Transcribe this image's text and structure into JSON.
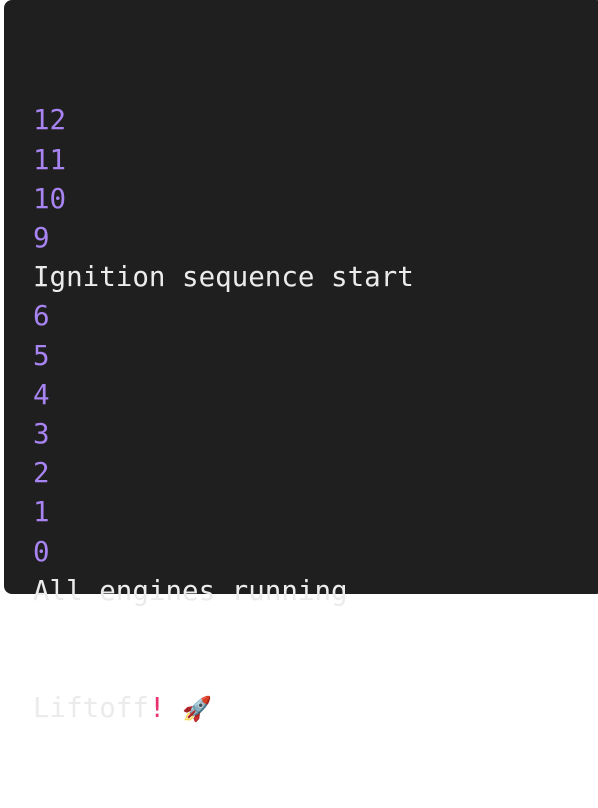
{
  "console": {
    "lines": [
      {
        "type": "number",
        "text": "12"
      },
      {
        "type": "number",
        "text": "11"
      },
      {
        "type": "number",
        "text": "10"
      },
      {
        "type": "number",
        "text": "9"
      },
      {
        "type": "text",
        "text": "Ignition sequence start"
      },
      {
        "type": "number",
        "text": "6"
      },
      {
        "type": "number",
        "text": "5"
      },
      {
        "type": "number",
        "text": "4"
      },
      {
        "type": "number",
        "text": "3"
      },
      {
        "type": "number",
        "text": "2"
      },
      {
        "type": "number",
        "text": "1"
      },
      {
        "type": "number",
        "text": "0"
      },
      {
        "type": "text",
        "text": "All engines running"
      }
    ],
    "last_line": {
      "text": "Liftoff",
      "punct": "!",
      "emoji": "🚀"
    }
  },
  "colors": {
    "background": "#1f1f1f",
    "text": "#ebebeb",
    "number": "#a884f3",
    "punct": "#e8336e"
  }
}
